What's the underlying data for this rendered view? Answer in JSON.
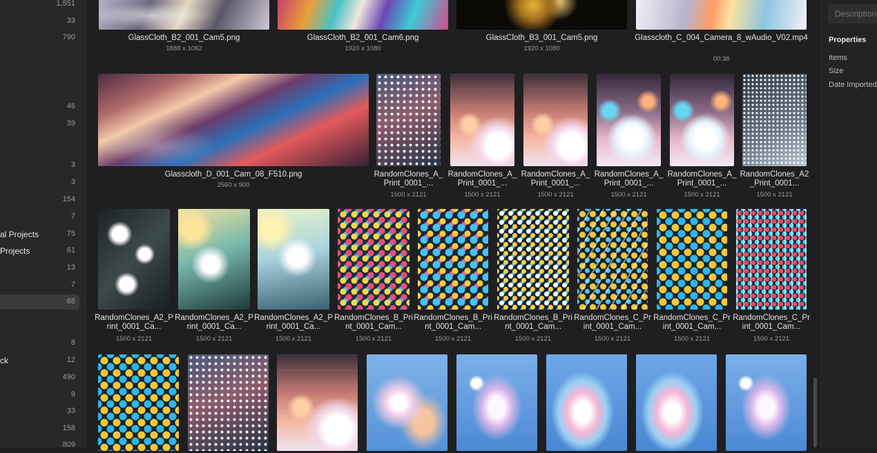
{
  "sidebar": {
    "rows": [
      {
        "label": "",
        "count": "1,551"
      },
      {
        "label": "",
        "count": "33"
      },
      {
        "label": "",
        "count": "790"
      },
      {
        "label": "",
        "count": "46"
      },
      {
        "label": "",
        "count": "39"
      },
      {
        "label": "",
        "count": "3"
      },
      {
        "label": "",
        "count": "3"
      },
      {
        "label": "",
        "count": "154"
      },
      {
        "label": "",
        "count": "7"
      },
      {
        "label": "al Projects",
        "count": "75"
      },
      {
        "label": "Projects",
        "count": "61"
      },
      {
        "label": "",
        "count": "13"
      },
      {
        "label": "",
        "count": "7"
      },
      {
        "label": "",
        "count": "68"
      },
      {
        "label": "",
        "count": "8"
      },
      {
        "label": "ck",
        "count": "12"
      },
      {
        "label": "",
        "count": "490"
      },
      {
        "label": "",
        "count": "9"
      },
      {
        "label": "",
        "count": "33"
      },
      {
        "label": "",
        "count": "158"
      },
      {
        "label": "",
        "count": "809"
      }
    ]
  },
  "right_panel": {
    "description_placeholder": "Description",
    "properties_header": "Properties",
    "properties": [
      "Items",
      "Size",
      "Date Imported"
    ]
  },
  "grid": {
    "row1": [
      {
        "name": "GlassCloth_B2_001_Cam5.png",
        "dims": "1888 x 1062",
        "thumb": "glass1"
      },
      {
        "name": "GlassCloth_B2_001_Cam6.png",
        "dims": "1920 x 1080",
        "thumb": "glass2"
      },
      {
        "name": "GlassCloth_B3_001_Cam5.png",
        "dims": "1920 x 1080",
        "thumb": "dark"
      },
      {
        "name": "Glasscloth_C_004_Camera_8_wAudio_V02.mp4",
        "dims": "00:38",
        "thumb": "glass4"
      }
    ],
    "row2": [
      {
        "name": "Glasscloth_D_001_Cam_08_F510.png",
        "dims": "2560 x 900",
        "thumb": "glassD"
      },
      {
        "name": "RandomClones_A_Print_0001_...",
        "dims": "1500 x 2121",
        "thumb": "dots"
      },
      {
        "name": "RandomClones_A_Print_0001_...",
        "dims": "1500 x 2121",
        "thumb": "cubes"
      },
      {
        "name": "RandomClones_A_Print_0001_...",
        "dims": "1500 x 2121",
        "thumb": "cubes"
      },
      {
        "name": "RandomClones_A_Print_0001_...",
        "dims": "1500 x 2121",
        "thumb": "cubes2"
      },
      {
        "name": "RandomClones_A_Print_0001_...",
        "dims": "1500 x 2121",
        "thumb": "cubes2"
      },
      {
        "name": "RandomClones_A2_Print_0001...",
        "dims": "1500 x 2121",
        "thumb": "grid"
      }
    ],
    "row3": [
      {
        "name": "RandomClones_A2_Print_0001_Ca...",
        "dims": "1500 x 2121",
        "thumb": "dark-cubes"
      },
      {
        "name": "RandomClones_A2_Print_0001_Ca...",
        "dims": "1500 x 2121",
        "thumb": "blur-cubes"
      },
      {
        "name": "RandomClones_A2_Print_0001_Ca...",
        "dims": "1500 x 2121",
        "thumb": "blur-cubes2"
      },
      {
        "name": "RandomClones_B_Print_0001_Cam...",
        "dims": "1500 x 2121",
        "thumb": "hex"
      },
      {
        "name": "RandomClones_B_Print_0001_Cam...",
        "dims": "1500 x 2121",
        "thumb": "hex2"
      },
      {
        "name": "RandomClones_B_Print_0001_Cam...",
        "dims": "1500 x 2121",
        "thumb": "hex3"
      },
      {
        "name": "RandomClones_C_Print_0001_Cam...",
        "dims": "1500 x 2121",
        "thumb": "streak"
      },
      {
        "name": "RandomClones_C_Print_0001_Cam...",
        "dims": "1500 x 2121",
        "thumb": "hex4"
      },
      {
        "name": "RandomClones_C_Print_0001_Cam...",
        "dims": "1500 x 2121",
        "thumb": "vert"
      }
    ],
    "row4": [
      {
        "thumb": "hex4"
      },
      {
        "thumb": "dots"
      },
      {
        "thumb": "cubes"
      },
      {
        "thumb": "blobs"
      },
      {
        "thumb": "blobs2"
      },
      {
        "thumb": "blobs3"
      },
      {
        "thumb": "blobs3"
      },
      {
        "thumb": "blobs2"
      }
    ]
  }
}
